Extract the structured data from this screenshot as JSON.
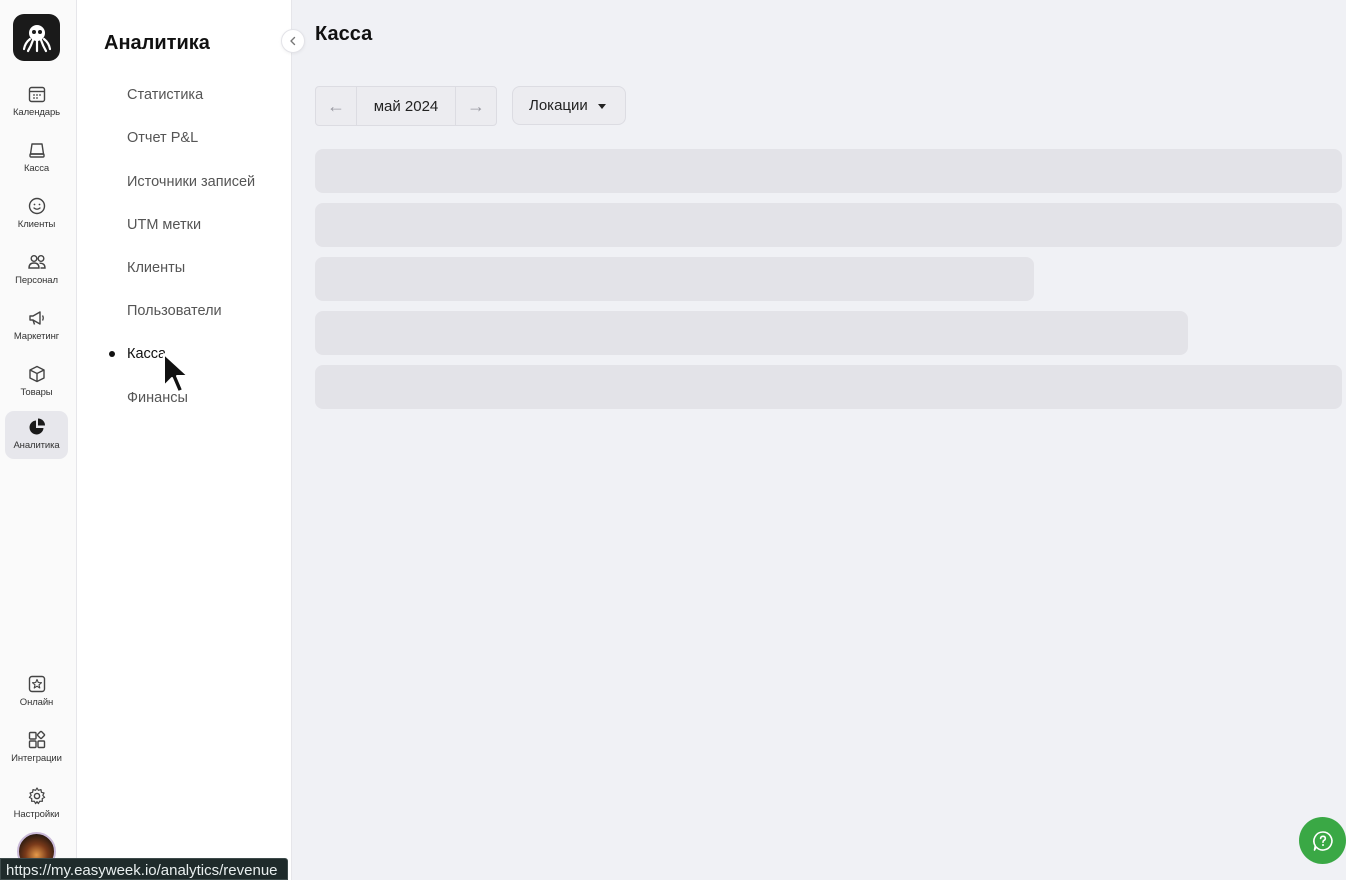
{
  "rail": {
    "items": [
      {
        "label": "Календарь",
        "icon": "calendar-icon"
      },
      {
        "label": "Касса",
        "icon": "register-icon"
      },
      {
        "label": "Клиенты",
        "icon": "smiley-icon"
      },
      {
        "label": "Персонал",
        "icon": "staff-icon"
      },
      {
        "label": "Маркетинг",
        "icon": "megaphone-icon"
      },
      {
        "label": "Товары",
        "icon": "box-icon"
      },
      {
        "label": "Аналитика",
        "icon": "pie-chart-icon",
        "active": true
      }
    ],
    "bottom_items": [
      {
        "label": "Онлайн",
        "icon": "star-window-icon"
      },
      {
        "label": "Интеграции",
        "icon": "integrations-icon"
      },
      {
        "label": "Настройки",
        "icon": "gear-icon"
      }
    ]
  },
  "panel": {
    "title": "Аналитика",
    "items": [
      {
        "label": "Статистика"
      },
      {
        "label": "Отчет P&L"
      },
      {
        "label": "Источники записей"
      },
      {
        "label": "UTM метки"
      },
      {
        "label": "Клиенты"
      },
      {
        "label": "Пользователи"
      },
      {
        "label": "Касса",
        "active": true
      },
      {
        "label": "Финансы"
      }
    ]
  },
  "main": {
    "title": "Касса",
    "month": "май 2024",
    "prev_arrow": "←",
    "next_arrow": "→",
    "locations_label": "Локации"
  },
  "status_url": "https://my.easyweek.io/analytics/revenue",
  "colors": {
    "accent_green": "#3aa845",
    "skeleton": "#e3e3e8",
    "background": "#f0f1f5"
  }
}
